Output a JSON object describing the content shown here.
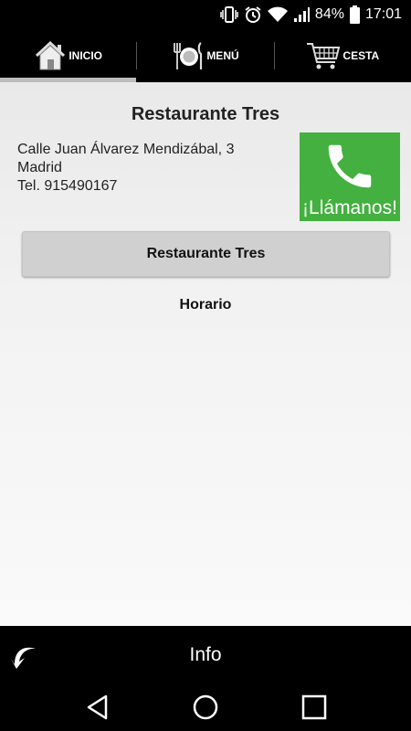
{
  "status_bar": {
    "battery": "84%",
    "time": "17:01"
  },
  "tabs": [
    {
      "label": "INICIO",
      "icon": "home-icon",
      "active": true
    },
    {
      "label": "MENÚ",
      "icon": "plate-icon",
      "active": false
    },
    {
      "label": "CESTA",
      "icon": "cart-icon",
      "active": false
    }
  ],
  "restaurant": {
    "title": "Restaurante Tres",
    "address_line1": "Calle Juan Álvarez Mendizábal, 3",
    "address_line2": "Madrid",
    "phone": "Tel. 915490167",
    "call_label": "¡Llámanos!",
    "name_button": "Restaurante Tres",
    "schedule_label": "Horario"
  },
  "footer": {
    "title": "Info"
  },
  "colors": {
    "call_green": "#43b03f",
    "tab_indicator": "#bdbdbd",
    "content_bg": "#f0f0f0"
  }
}
